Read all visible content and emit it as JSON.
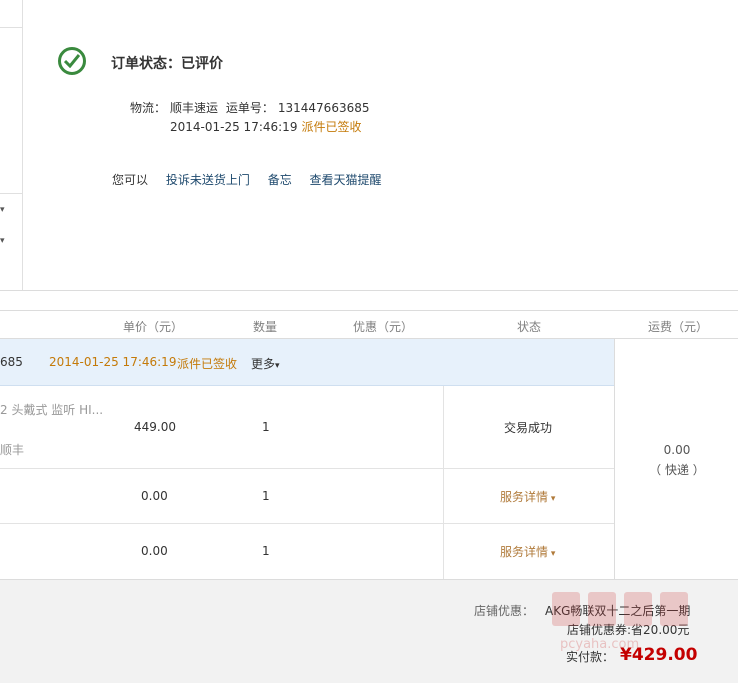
{
  "order_status": {
    "label": "订单状态：",
    "value": "已评价",
    "logistics_label": "物流：",
    "carrier": "顺丰速运",
    "tracking_label": "运单号：",
    "tracking_number": "131447663685",
    "timestamp": "2014-01-25 17:46:19",
    "delivery_status": "派件已签收",
    "actions_prefix": "您可以",
    "actions": [
      "投诉未送货上门",
      "备忘",
      "查看天猫提醒"
    ]
  },
  "table": {
    "headers": {
      "unit_price": "单价（元）",
      "quantity": "数量",
      "discount": "优惠（元）",
      "status": "状态",
      "shipping": "运费（元）"
    },
    "order_row": {
      "tracking_partial": "685",
      "timestamp": "2014-01-25 17:46:19",
      "status": "派件已签收",
      "more": "更多"
    },
    "items": [
      {
        "name": "2 头戴式 监听 HI...",
        "sub": "顺丰",
        "price": "449.00",
        "qty": "1",
        "status": "交易成功"
      },
      {
        "price": "0.00",
        "qty": "1",
        "status": "服务详情"
      },
      {
        "price": "0.00",
        "qty": "1",
        "status": "服务详情"
      }
    ],
    "shipping": {
      "amount": "0.00",
      "method": "（ 快递 ）"
    }
  },
  "footer": {
    "discount_label": "店铺优惠：",
    "discount_line1": "AKG畅联双十二之后第一期",
    "discount_line2": "店铺优惠券:省20.00元",
    "paid_label": "实付款：",
    "paid_amount": "¥429.00"
  },
  "watermark": {
    "text": "pcyaha.com"
  },
  "colors": {
    "accent_green": "#3a8a3e",
    "link": "#1f4a6e",
    "orange": "#c47a09",
    "price_red": "#c40000",
    "row_blue": "#e7f1fb"
  }
}
